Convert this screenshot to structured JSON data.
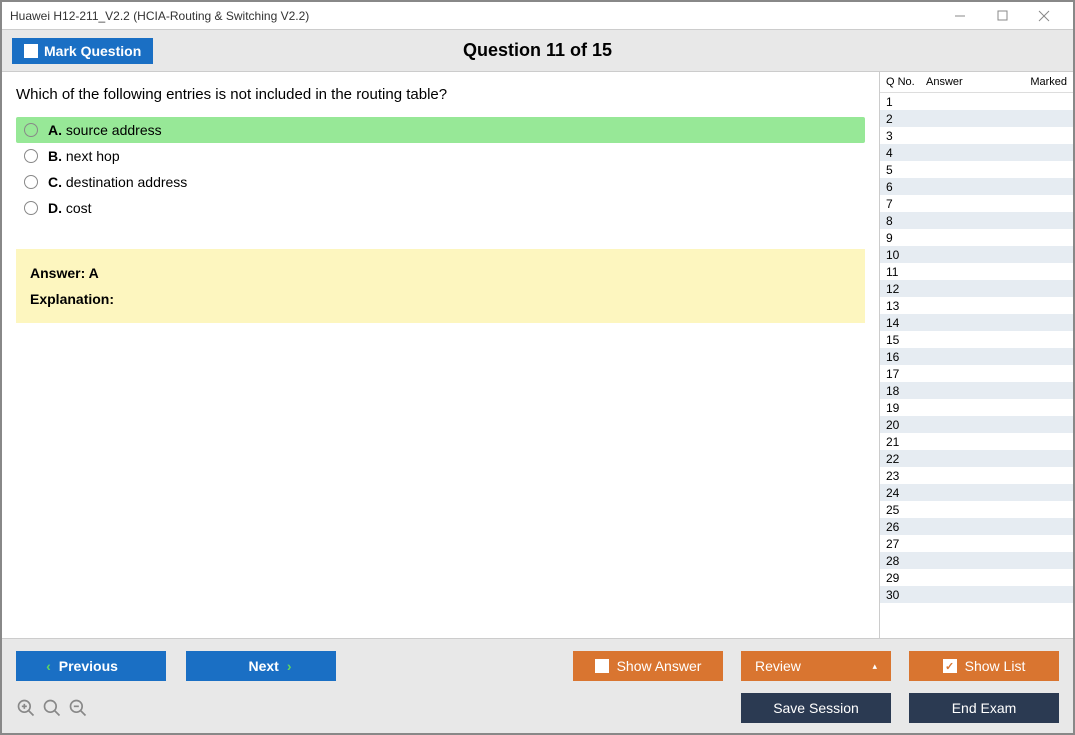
{
  "window": {
    "title": "Huawei H12-211_V2.2 (HCIA-Routing & Switching V2.2)"
  },
  "header": {
    "mark_label": "Mark Question",
    "counter": "Question 11 of 15"
  },
  "question": {
    "text": "Which of the following entries is not included in the routing table?",
    "options": [
      {
        "letter": "A.",
        "text": "source address",
        "highlighted": true
      },
      {
        "letter": "B.",
        "text": "next hop",
        "highlighted": false
      },
      {
        "letter": "C.",
        "text": "destination address",
        "highlighted": false
      },
      {
        "letter": "D.",
        "text": "cost",
        "highlighted": false
      }
    ]
  },
  "answer_box": {
    "answer_label": "Answer: A",
    "explanation_label": "Explanation:"
  },
  "sidepanel": {
    "headers": {
      "qno": "Q No.",
      "answer": "Answer",
      "marked": "Marked"
    },
    "rows": [
      1,
      2,
      3,
      4,
      5,
      6,
      7,
      8,
      9,
      10,
      11,
      12,
      13,
      14,
      15,
      16,
      17,
      18,
      19,
      20,
      21,
      22,
      23,
      24,
      25,
      26,
      27,
      28,
      29,
      30
    ]
  },
  "footer": {
    "previous": "Previous",
    "next": "Next",
    "show_answer": "Show Answer",
    "review": "Review",
    "show_list": "Show List",
    "save_session": "Save Session",
    "end_exam": "End Exam"
  }
}
